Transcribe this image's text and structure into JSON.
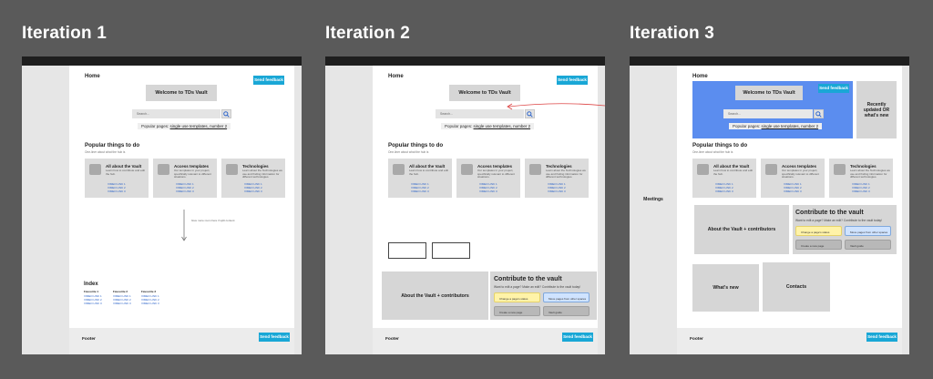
{
  "iterations": [
    {
      "title": "Iteration 1"
    },
    {
      "title": "Iteration 2"
    },
    {
      "title": "Iteration 3"
    }
  ],
  "common": {
    "home": "Home",
    "send_feedback": "Send feedback",
    "welcome": "Welcome to TDs Vault",
    "search_placeholder": "Search...",
    "popular_label": "Popular pages:",
    "popular_links": "single use templates, number 2",
    "popular_heading": "Popular things to do",
    "popular_sub": "One-liner about what the hub is",
    "cards": [
      {
        "title": "All about the Vault",
        "desc": "Learn how to contribute and edit the hub.",
        "links": [
          "VIMEO LINK 1",
          "VIMEO LINK 2",
          "VIMEO LINK 3"
        ]
      },
      {
        "title": "Access templates",
        "desc": "Our templates in your project, specifically relevant to different situations.",
        "links": [
          "VIMEO LINK 1",
          "VIMEO LINK 2",
          "VIMEO LINK 3"
        ]
      },
      {
        "title": "Technologies",
        "desc": "Learn about the Technologies we use and finding information for different technologies.",
        "links": [
          "VIMEO LINK 1",
          "VIMEO LINK 2",
          "VIMEO LINK 3"
        ]
      }
    ],
    "footer": "Footer",
    "about_vault": "About the Vault + contributors",
    "contribute_title": "Contribute to the vault",
    "contribute_sub": "Want to edit a page? Make an edit? Contribute to the vault today!",
    "pills": [
      "Change a page's status",
      "Move pages from other spaces",
      "Create a new page",
      "Vault guide"
    ]
  },
  "iteration1": {
    "scroll_note": "Give more room here if split content",
    "index_title": "Index",
    "index_cols": [
      {
        "head": "Favourite 1",
        "links": [
          "VIMEO LINK 1",
          "VIMEO LINK 2",
          "VIMEO LINK 3"
        ]
      },
      {
        "head": "Favourite 2",
        "links": [
          "VIMEO LINK 1",
          "VIMEO LINK 2",
          "VIMEO LINK 3"
        ]
      },
      {
        "head": "Favourite 3",
        "links": [
          "VIMEO LINK 1",
          "VIMEO LINK 2",
          "VIMEO LINK 3"
        ]
      }
    ]
  },
  "iteration3": {
    "recently": "Recently updated OR what's new",
    "meetings": "Meetings",
    "whats_new": "What's new",
    "contacts": "Contacts"
  },
  "colors": {
    "background": "#5a5a5a",
    "accent": "#19a7d6",
    "hero_blue": "#5b8def",
    "link": "#2b63c9"
  }
}
